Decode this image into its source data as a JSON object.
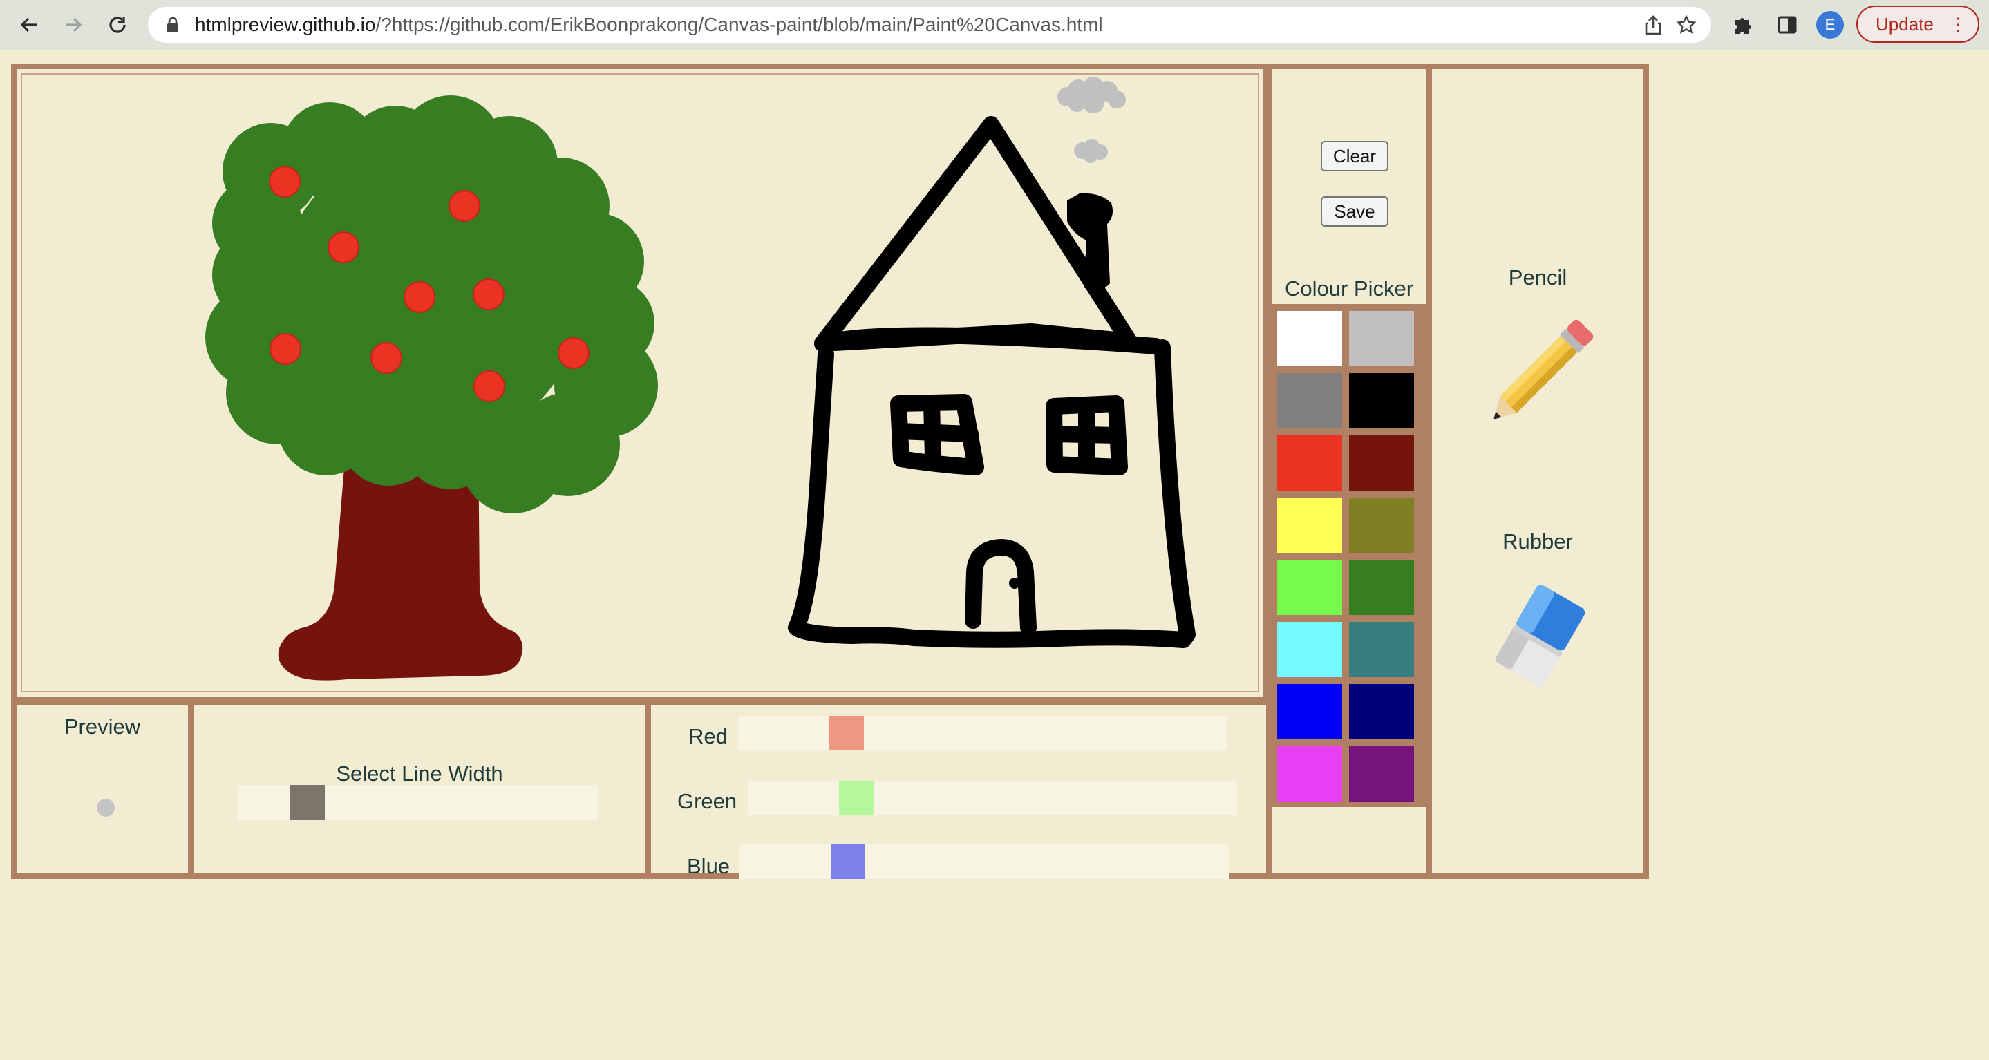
{
  "browser": {
    "url_host": "htmlpreview.github.io",
    "url_rest": "/?https://github.com/ErikBoonprakong/Canvas-paint/blob/main/Paint%20Canvas.html",
    "profile_initial": "E",
    "update_label": "Update"
  },
  "app": {
    "clear_label": "Clear",
    "save_label": "Save",
    "colour_picker_title": "Colour Picker",
    "palette": [
      "#ffffff",
      "#c0c0c0",
      "#808080",
      "#000000",
      "#ea3323",
      "#75140c",
      "#ffff54",
      "#807f26",
      "#75fb4c",
      "#377d22",
      "#73fbfd",
      "#367e7f",
      "#0000f5",
      "#00007b",
      "#ea3ff7",
      "#75147c"
    ],
    "pencil_label": "Pencil",
    "rubber_label": "Rubber",
    "preview_label": "Preview",
    "line_width_label": "Select Line Width",
    "red_label": "Red",
    "green_label": "Green",
    "blue_label": "Blue",
    "preview_color": "#c4c4c4",
    "line_width_level": 0.16,
    "red_level": 0.2,
    "green_level": 0.2,
    "blue_level": 0.2,
    "colors": {
      "panel_border": "#b08063",
      "background": "#f1ecd2",
      "tree_leaves": "#377d22",
      "tree_trunk": "#75140c",
      "apples": "#ea3323",
      "house_lines": "#000000",
      "smoke": "#c0c0c0",
      "red_thumb": "#ef9782",
      "green_thumb": "#b6f79e",
      "blue_thumb": "#8080eb",
      "width_thumb": "#7b7669"
    }
  }
}
